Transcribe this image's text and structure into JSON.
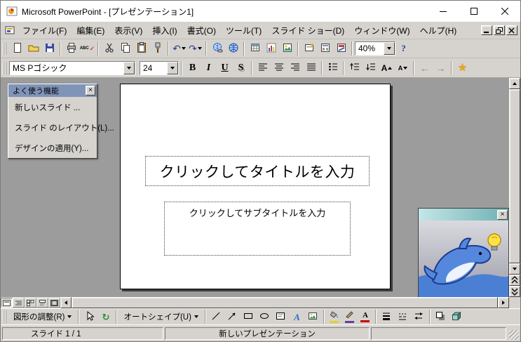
{
  "colors": {
    "toolbar_bg": "#d6d3ce",
    "workspace_bg": "#9c9c9c",
    "slide_bg": "#ffffff",
    "palette_title_bg": "#8094b8",
    "assistant_teal": "#6fb0b4",
    "fill_color_swatch": "#e8d020",
    "line_color_swatch": "#6040a0",
    "font_color_swatch": "#cc0000"
  },
  "titlebar": {
    "title": "Microsoft PowerPoint - [プレゼンテーション1]"
  },
  "menubar": {
    "items": [
      {
        "label": "ファイル(F)"
      },
      {
        "label": "編集(E)"
      },
      {
        "label": "表示(V)"
      },
      {
        "label": "挿入(I)"
      },
      {
        "label": "書式(O)"
      },
      {
        "label": "ツール(T)"
      },
      {
        "label": "スライド ショー(D)"
      },
      {
        "label": "ウィンドウ(W)"
      },
      {
        "label": "ヘルプ(H)"
      }
    ]
  },
  "standard_toolbar": {
    "spell": "ABC",
    "spell_check": "✓",
    "undo": "↶",
    "redo": "↷",
    "zoom": "40%",
    "help": "?"
  },
  "formatting_toolbar": {
    "font_name": "MS Pゴシック",
    "font_size": "24",
    "bold": "B",
    "italic": "I",
    "underline": "U",
    "shadow": "S",
    "font_increase": "A",
    "font_decrease": "A",
    "promote": "←",
    "demote": "→",
    "common_tasks": "★"
  },
  "palette": {
    "title": "よく使う機能",
    "close": "×",
    "items": [
      {
        "label": "新しいスライド ..."
      },
      {
        "label": "スライド のレイアウト(L)..."
      },
      {
        "label": "デザインの適用(Y)..."
      }
    ]
  },
  "slide": {
    "title_placeholder": "クリックしてタイトルを入力",
    "subtitle_placeholder": "クリックしてサブタイトルを入力"
  },
  "assistant": {
    "close": "×",
    "character": "dolphin-with-lightbulb"
  },
  "drawing_toolbar": {
    "draw_label": "図形の調整(R)",
    "autoshapes_label": "オートシェイプ(U)",
    "rotate": "↻",
    "wordart": "A",
    "fontcolor_letter": "A"
  },
  "statusbar": {
    "slide_info": "スライド 1 / 1",
    "template_name": "新しいプレゼンテーション"
  }
}
